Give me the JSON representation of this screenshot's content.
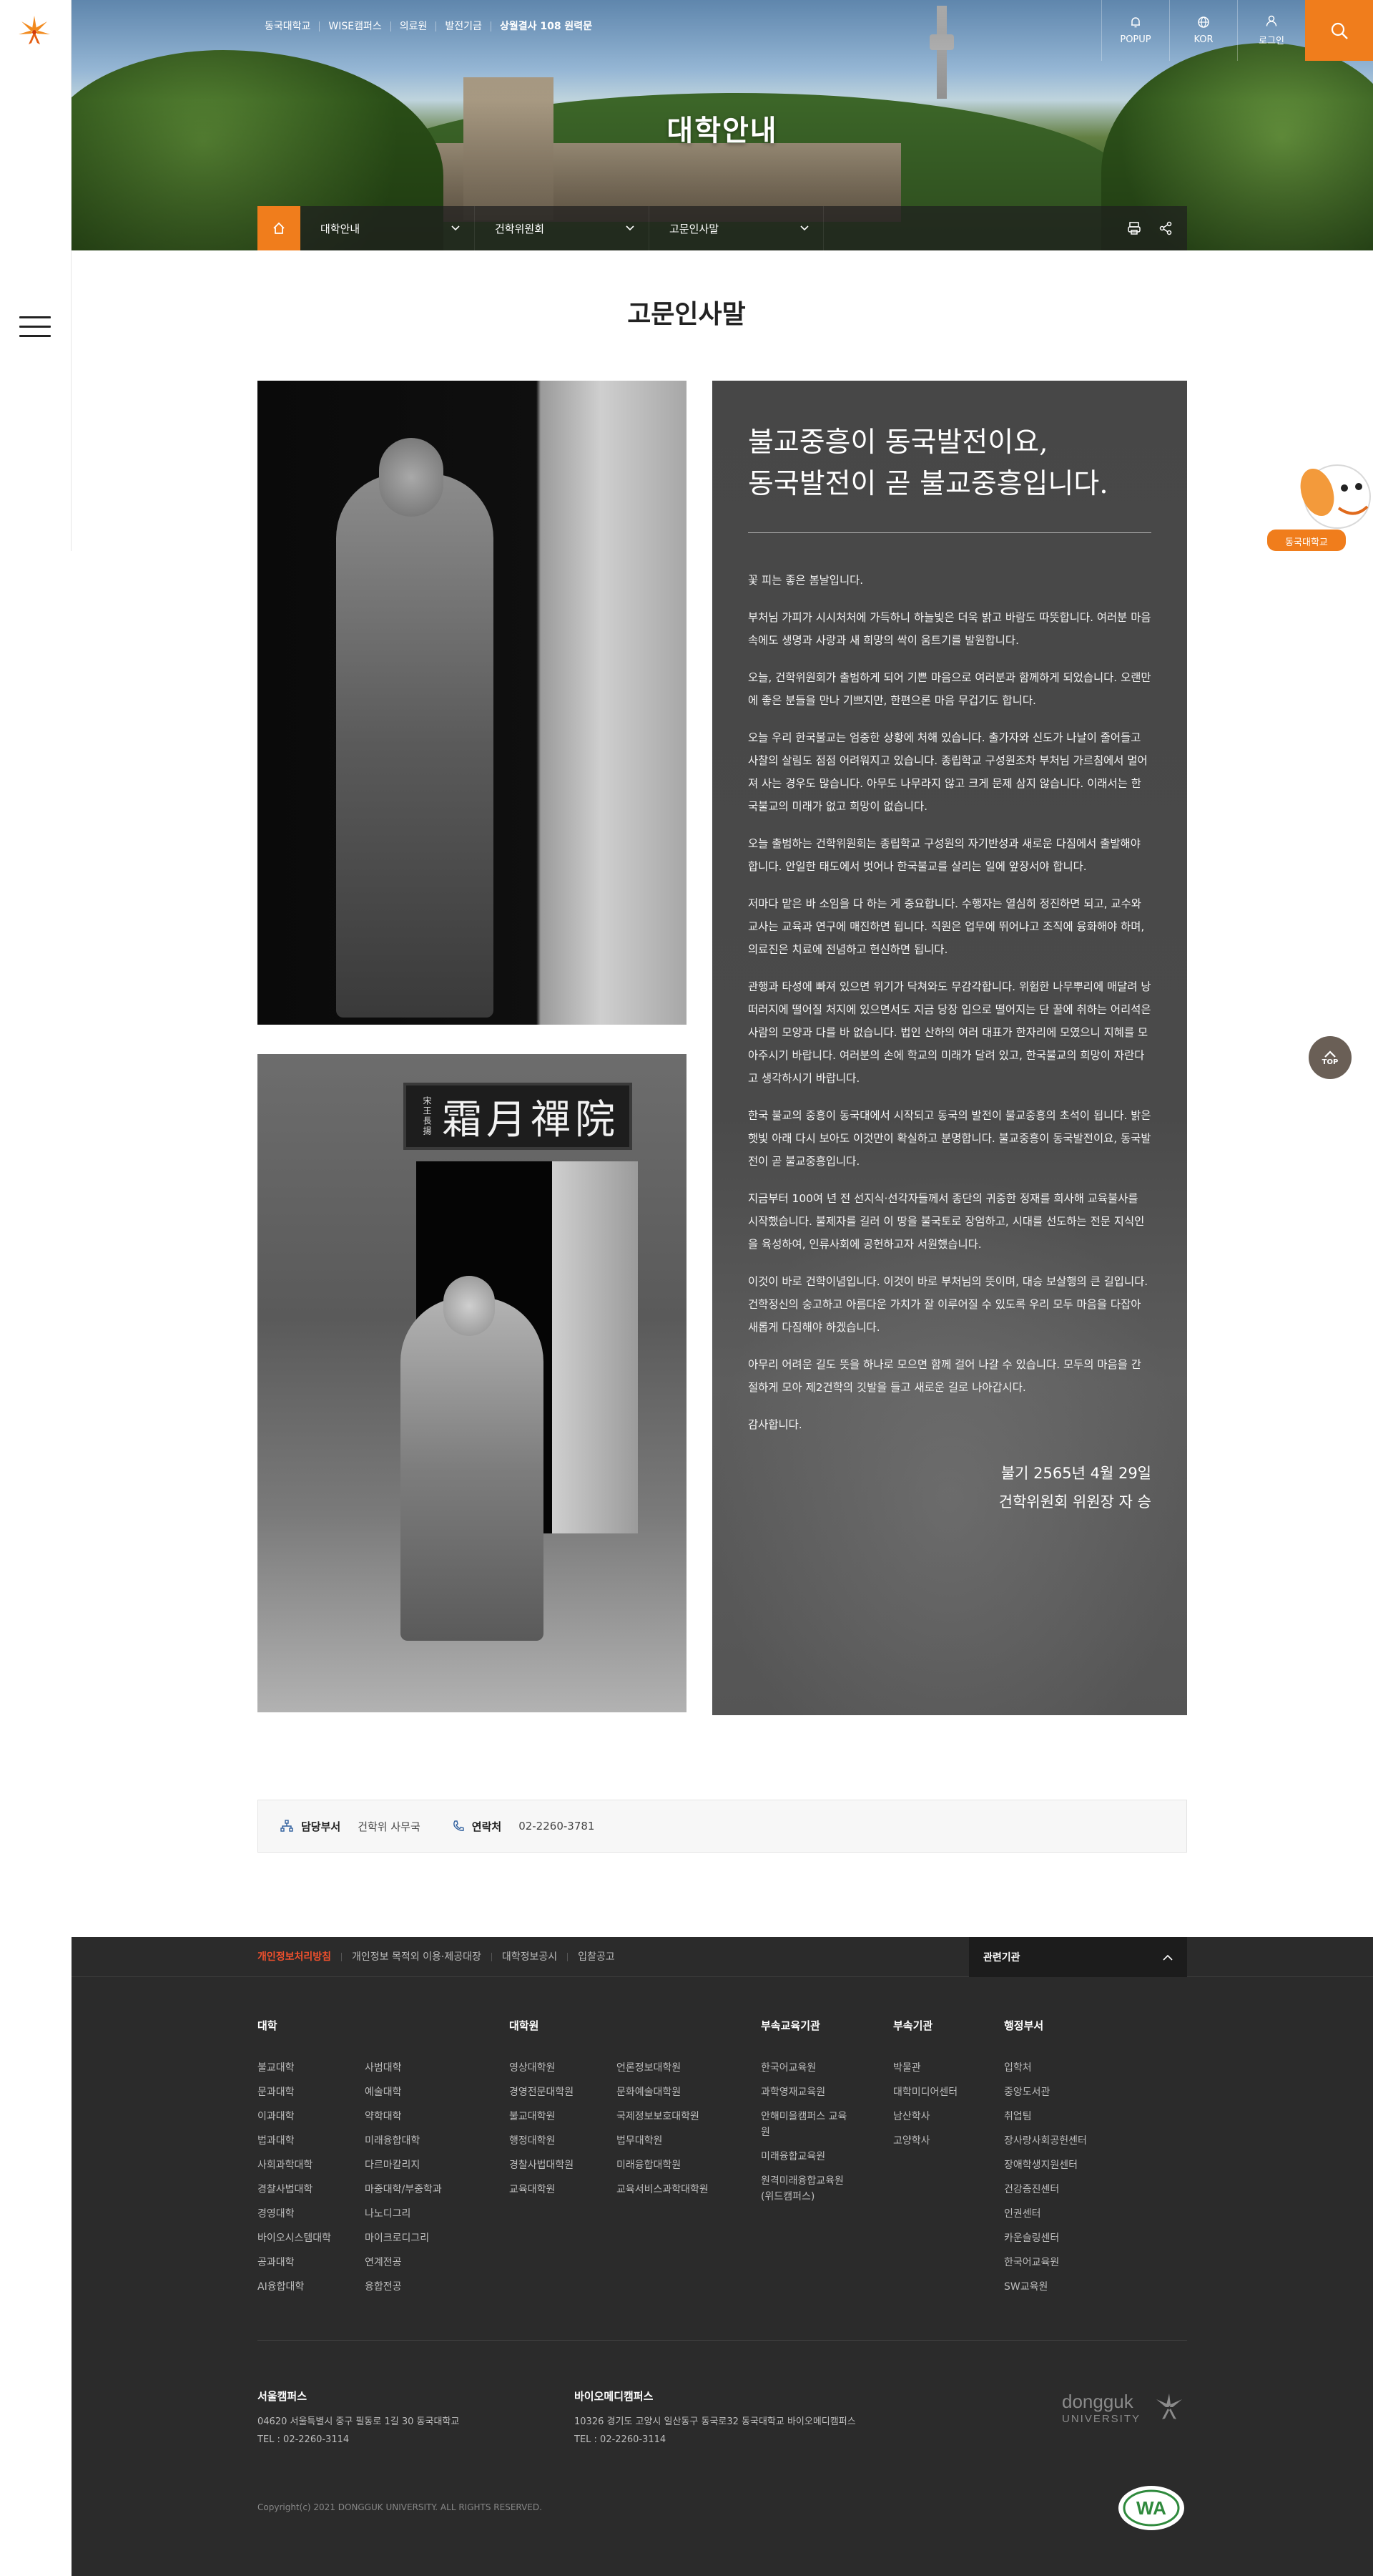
{
  "topnav": [
    "동국대학교",
    "WISE캠퍼스",
    "의료원",
    "발전기금",
    "상월결사 108 원력문"
  ],
  "util": [
    "POPUP",
    "KOR",
    "로그인"
  ],
  "hero": {
    "title": "대학안내"
  },
  "location": {
    "level1": "대학안내",
    "level2": "건학위원회",
    "level3": "고문인사말"
  },
  "page_title": "고문인사말",
  "photo2_sign": {
    "main": "霜月禪院",
    "small": "宋王長揚"
  },
  "message": {
    "headline1": "불교중흥이 동국발전이요,",
    "headline2": "동국발전이 곧 불교중흥입니다.",
    "paragraphs": [
      "꽃 피는 좋은 봄날입니다.",
      "부처님 가피가 시시처처에 가득하니 하늘빛은 더욱 밝고 바람도 따뜻합니다. 여러분 마음속에도 생명과 사랑과 새 희망의 싹이 움트기를 발원합니다.",
      "오늘, 건학위원회가 출범하게 되어 기쁜 마음으로 여러분과 함께하게 되었습니다. 오랜만에 좋은 분들을 만나 기쁘지만, 한편으론 마음 무겁기도 합니다.",
      "오늘 우리 한국불교는 엄중한 상황에 처해 있습니다. 출가자와 신도가 나날이 줄어들고 사찰의 살림도 점점 어려워지고 있습니다. 종립학교 구성원조차 부처님 가르침에서 멀어져 사는 경우도 많습니다. 아무도 나무라지 않고 크게 문제 삼지 않습니다. 이래서는 한국불교의 미래가 없고 희망이 없습니다.",
      "오늘 출범하는 건학위원회는 종립학교 구성원의 자기반성과 새로운 다짐에서 출발해야 합니다. 안일한 태도에서 벗어나 한국불교를 살리는 일에 앞장서야 합니다.",
      "저마다 맡은 바 소임을 다 하는 게 중요합니다. 수행자는 열심히 정진하면 되고, 교수와 교사는 교육과 연구에 매진하면 됩니다. 직원은 업무에 뛰어나고 조직에 융화해야 하며, 의료진은 치료에 전념하고 헌신하면 됩니다.",
      "관행과 타성에 빠져 있으면 위기가 닥쳐와도 무감각합니다. 위험한 나무뿌리에 매달려 낭떠러지에 떨어질 처지에 있으면서도 지금 당장 입으로 떨어지는 단 꿀에 취하는 어리석은 사람의 모양과 다를 바 없습니다. 법인 산하의 여러 대표가 한자리에 모였으니 지혜를 모아주시기 바랍니다. 여러분의 손에 학교의 미래가 달려 있고, 한국불교의 희망이 자란다고 생각하시기 바랍니다.",
      "한국 불교의 중흥이 동국대에서 시작되고 동국의 발전이 불교중흥의 초석이 됩니다. 밝은 햇빛 아래 다시 보아도 이것만이 확실하고 분명합니다. 불교중흥이 동국발전이요, 동국발전이 곧 불교중흥입니다.",
      "지금부터 100여 년 전 선지식·선각자들께서 종단의 귀중한 정재를 희사해 교육불사를 시작했습니다. 불제자를 길러 이 땅을 불국토로 장엄하고, 시대를 선도하는 전문 지식인을 육성하여, 인류사회에 공헌하고자 서원했습니다.",
      "이것이 바로 건학이념입니다. 이것이 바로 부처님의 뜻이며, 대승 보살행의 큰 길입니다. 건학정신의 숭고하고 아름다운 가치가 잘 이루어질 수 있도록 우리 모두 마음을 다잡아 새롭게 다짐해야 하겠습니다.",
      "아무리 어려운 길도 뜻을 하나로 모으면 함께 걸어 나갈 수 있습니다. 모두의 마음을 간절하게 모아 제2건학의 깃발을 들고 새로운 길로 나아갑시다.",
      "감사합니다."
    ],
    "date": "불기 2565년 4월 29일",
    "signer": "건학위원회 위원장 자 승"
  },
  "dept": {
    "label": "담당부서",
    "value": "건학위 사무국",
    "contact_label": "연락처",
    "contact_value": "02-2260-3781"
  },
  "mascot_label": "동국대학교",
  "top_label": "TOP",
  "footer": {
    "links": [
      "개인정보처리방침",
      "개인정보 목적외 이용·제공대장",
      "대학정보공시",
      "입찰공고"
    ],
    "related": "관련기관",
    "columns": [
      {
        "title": "대학",
        "lists": [
          [
            "불교대학",
            "문과대학",
            "이과대학",
            "법과대학",
            "사회과학대학",
            "경찰사법대학",
            "경영대학",
            "바이오시스템대학",
            "공과대학",
            "AI융합대학"
          ],
          [
            "사범대학",
            "예술대학",
            "약학대학",
            "미래융합대학",
            "다르마칼리지",
            "마중대학/부중학과",
            "나노디그리",
            "마이크로디그리",
            "연계전공",
            "융합전공"
          ]
        ]
      },
      {
        "title": "대학원",
        "lists": [
          [
            "영상대학원",
            "경영전문대학원",
            "불교대학원",
            "행정대학원",
            "경찰사법대학원",
            "교육대학원"
          ],
          [
            "언론정보대학원",
            "문화예술대학원",
            "국제정보보호대학원",
            "법무대학원",
            "미래융합대학원",
            "교육서비스과학대학원"
          ]
        ]
      },
      {
        "title": "부속교육기관",
        "lists": [
          [
            "한국어교육원",
            "과학영재교육원",
            "안해미을캠퍼스 교육원",
            "미래융합교육원",
            "원격미래융합교육원(위드캠퍼스)"
          ]
        ]
      },
      {
        "title": "부속기관",
        "lists": [
          [
            "박물관",
            "대학미디어센터",
            "남산학사",
            "고양학사"
          ]
        ]
      },
      {
        "title": "행정부서",
        "lists": [
          [
            "입학처",
            "중앙도서관",
            "취업팀",
            "장사랑사회공헌센터",
            "장애학생지원센터",
            "건강증진센터",
            "인권센터",
            "카운슬링센터",
            "한국어교육원",
            "SW교육원"
          ]
        ]
      }
    ],
    "campus_seoul": {
      "name": "서울캠퍼스",
      "address": "04620 서울특별시 중구 필동로 1길 30 동국대학교",
      "tel": "TEL : 02-2260-3114"
    },
    "campus_bio": {
      "name": "바이오메디캠퍼스",
      "address": "10326 경기도 고양시 일산동구 동국로32 동국대학교 바이오메디캠퍼스",
      "tel": "TEL : 02-2260-3114"
    },
    "logo_text": "dongguk",
    "logo_sub": "UNIVERSITY",
    "wa_text": "WA",
    "copyright": "Copyright(c) 2021 DONGGUK UNIVERSITY. ALL RIGHTS RESERVED."
  },
  "colors": {
    "accent": "#f07d1c",
    "footer_bg": "#2b2b2b",
    "panel_bg": "#474747"
  },
  "icons": [
    "logo-icon",
    "menu-icon",
    "bell-icon",
    "globe-icon",
    "user-icon",
    "search-icon",
    "home-icon",
    "chevron-down-icon",
    "print-icon",
    "share-icon",
    "org-icon",
    "phone-icon",
    "arrow-up-icon",
    "chevron-up-icon"
  ]
}
